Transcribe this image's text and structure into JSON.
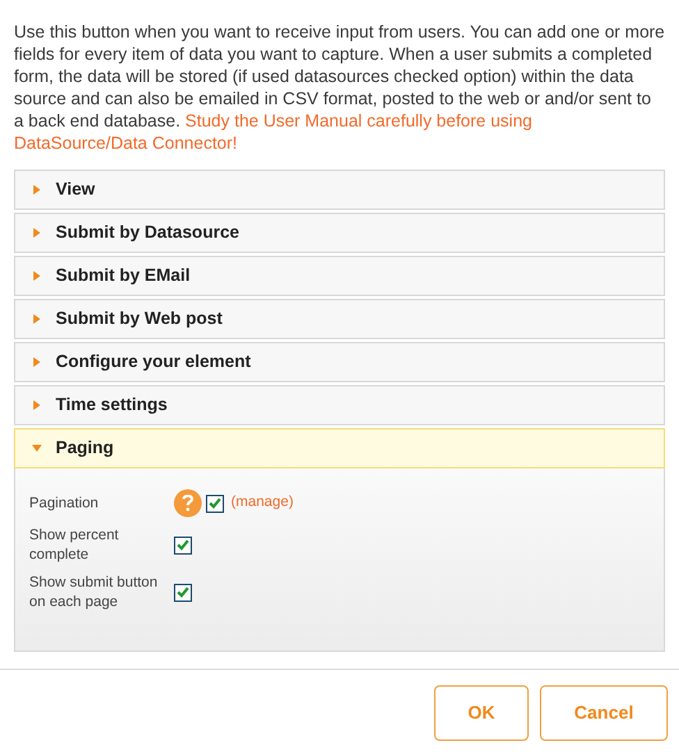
{
  "intro": {
    "text": "Use this button when you want to receive input from users. You can add one or more fields for every item of data you want to capture. When a user submits a completed form, the data will be stored (if used datasources checked option) within the data source and can also be emailed in CSV format, posted to the web or and/or sent to a back end database.",
    "notice": "Study the User Manual carefully before using DataSource/Data Connector!"
  },
  "sections": [
    {
      "title": "View",
      "expanded": false
    },
    {
      "title": "Submit by Datasource",
      "expanded": false
    },
    {
      "title": "Submit by EMail",
      "expanded": false
    },
    {
      "title": "Submit by Web post",
      "expanded": false
    },
    {
      "title": "Configure your element",
      "expanded": false
    },
    {
      "title": "Time settings",
      "expanded": false
    },
    {
      "title": "Paging",
      "expanded": true,
      "fields": [
        {
          "label": "Pagination",
          "checked": true,
          "help": true,
          "link": "(manage)"
        },
        {
          "label": "Show percent complete",
          "checked": true,
          "help": false
        },
        {
          "label": "Show submit button on each page",
          "checked": true,
          "help": false
        }
      ]
    }
  ],
  "buttons": [
    {
      "label": "OK"
    },
    {
      "label": "Cancel"
    }
  ]
}
